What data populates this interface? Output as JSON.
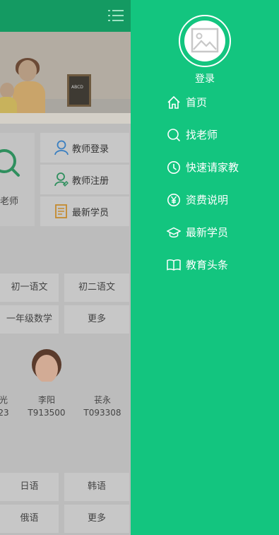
{
  "drawer": {
    "login_label": "登录",
    "nav": [
      {
        "label": "首页",
        "icon": "home-icon"
      },
      {
        "label": "找老师",
        "icon": "search-icon"
      },
      {
        "label": "快速请家教",
        "icon": "clock-icon"
      },
      {
        "label": "资费说明",
        "icon": "yen-icon"
      },
      {
        "label": "最新学员",
        "icon": "graduation-cap-icon"
      },
      {
        "label": "教育头条",
        "icon": "book-icon"
      }
    ],
    "color": "#13c57f"
  },
  "page": {
    "banner_board_text": "ABCD",
    "big_tile_label": "老师",
    "quick_buttons": [
      {
        "label": "教师登录",
        "icon": "user-icon"
      },
      {
        "label": "教师注册",
        "icon": "user-register-icon"
      },
      {
        "label": "最新学员",
        "icon": "document-icon"
      }
    ],
    "courses": [
      "初一语文",
      "初二语文",
      "一年级数学",
      "更多"
    ],
    "teachers": [
      {
        "name": "光",
        "id": "23"
      },
      {
        "name": "李阳",
        "id": "T913500"
      },
      {
        "name": "苌永",
        "id": "T093308"
      }
    ],
    "languages": [
      "日语",
      "韩语",
      "俄语",
      "更多"
    ],
    "header_color": "#149a62"
  }
}
